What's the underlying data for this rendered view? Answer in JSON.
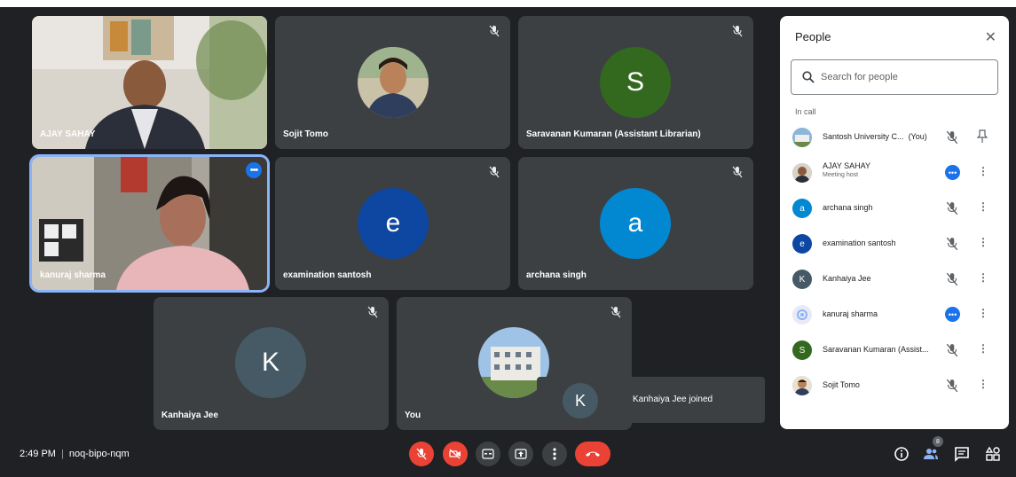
{
  "tiles": [
    {
      "name": "AJAY SAHAY"
    },
    {
      "name": "Sojit Tomo"
    },
    {
      "name": "Saravanan Kumaran (Assistant Librarian)",
      "initial": "S",
      "color": "#33691e"
    },
    {
      "name": "kanuraj sharma"
    },
    {
      "name": "examination santosh",
      "initial": "e",
      "color": "#0d47a1"
    },
    {
      "name": "archana singh",
      "initial": "a",
      "color": "#0288d1"
    },
    {
      "name": "Kanhaiya Jee",
      "initial": "K",
      "color": "#455a64"
    },
    {
      "name": "You"
    }
  ],
  "toast": {
    "initial": "K",
    "text": "Kanhaiya Jee joined"
  },
  "panel": {
    "title": "People",
    "search_placeholder": "Search for people",
    "section": "In call",
    "people": [
      {
        "name": "Santosh University C...",
        "suffix": "(You)"
      },
      {
        "name": "AJAY SAHAY",
        "sub": "Meeting host"
      },
      {
        "name": "archana singh",
        "initial": "a",
        "color": "#0288d1"
      },
      {
        "name": "examination santosh",
        "initial": "e",
        "color": "#0d47a1"
      },
      {
        "name": "Kanhaiya Jee",
        "initial": "K",
        "color": "#455a64"
      },
      {
        "name": "kanuraj sharma"
      },
      {
        "name": "Saravanan Kumaran (Assist...",
        "initial": "S",
        "color": "#33691e"
      },
      {
        "name": "Sojit Tomo"
      }
    ]
  },
  "footer": {
    "time": "2:49 PM",
    "separator": "|",
    "meeting_code": "noq-bipo-nqm",
    "people_count": "8"
  }
}
